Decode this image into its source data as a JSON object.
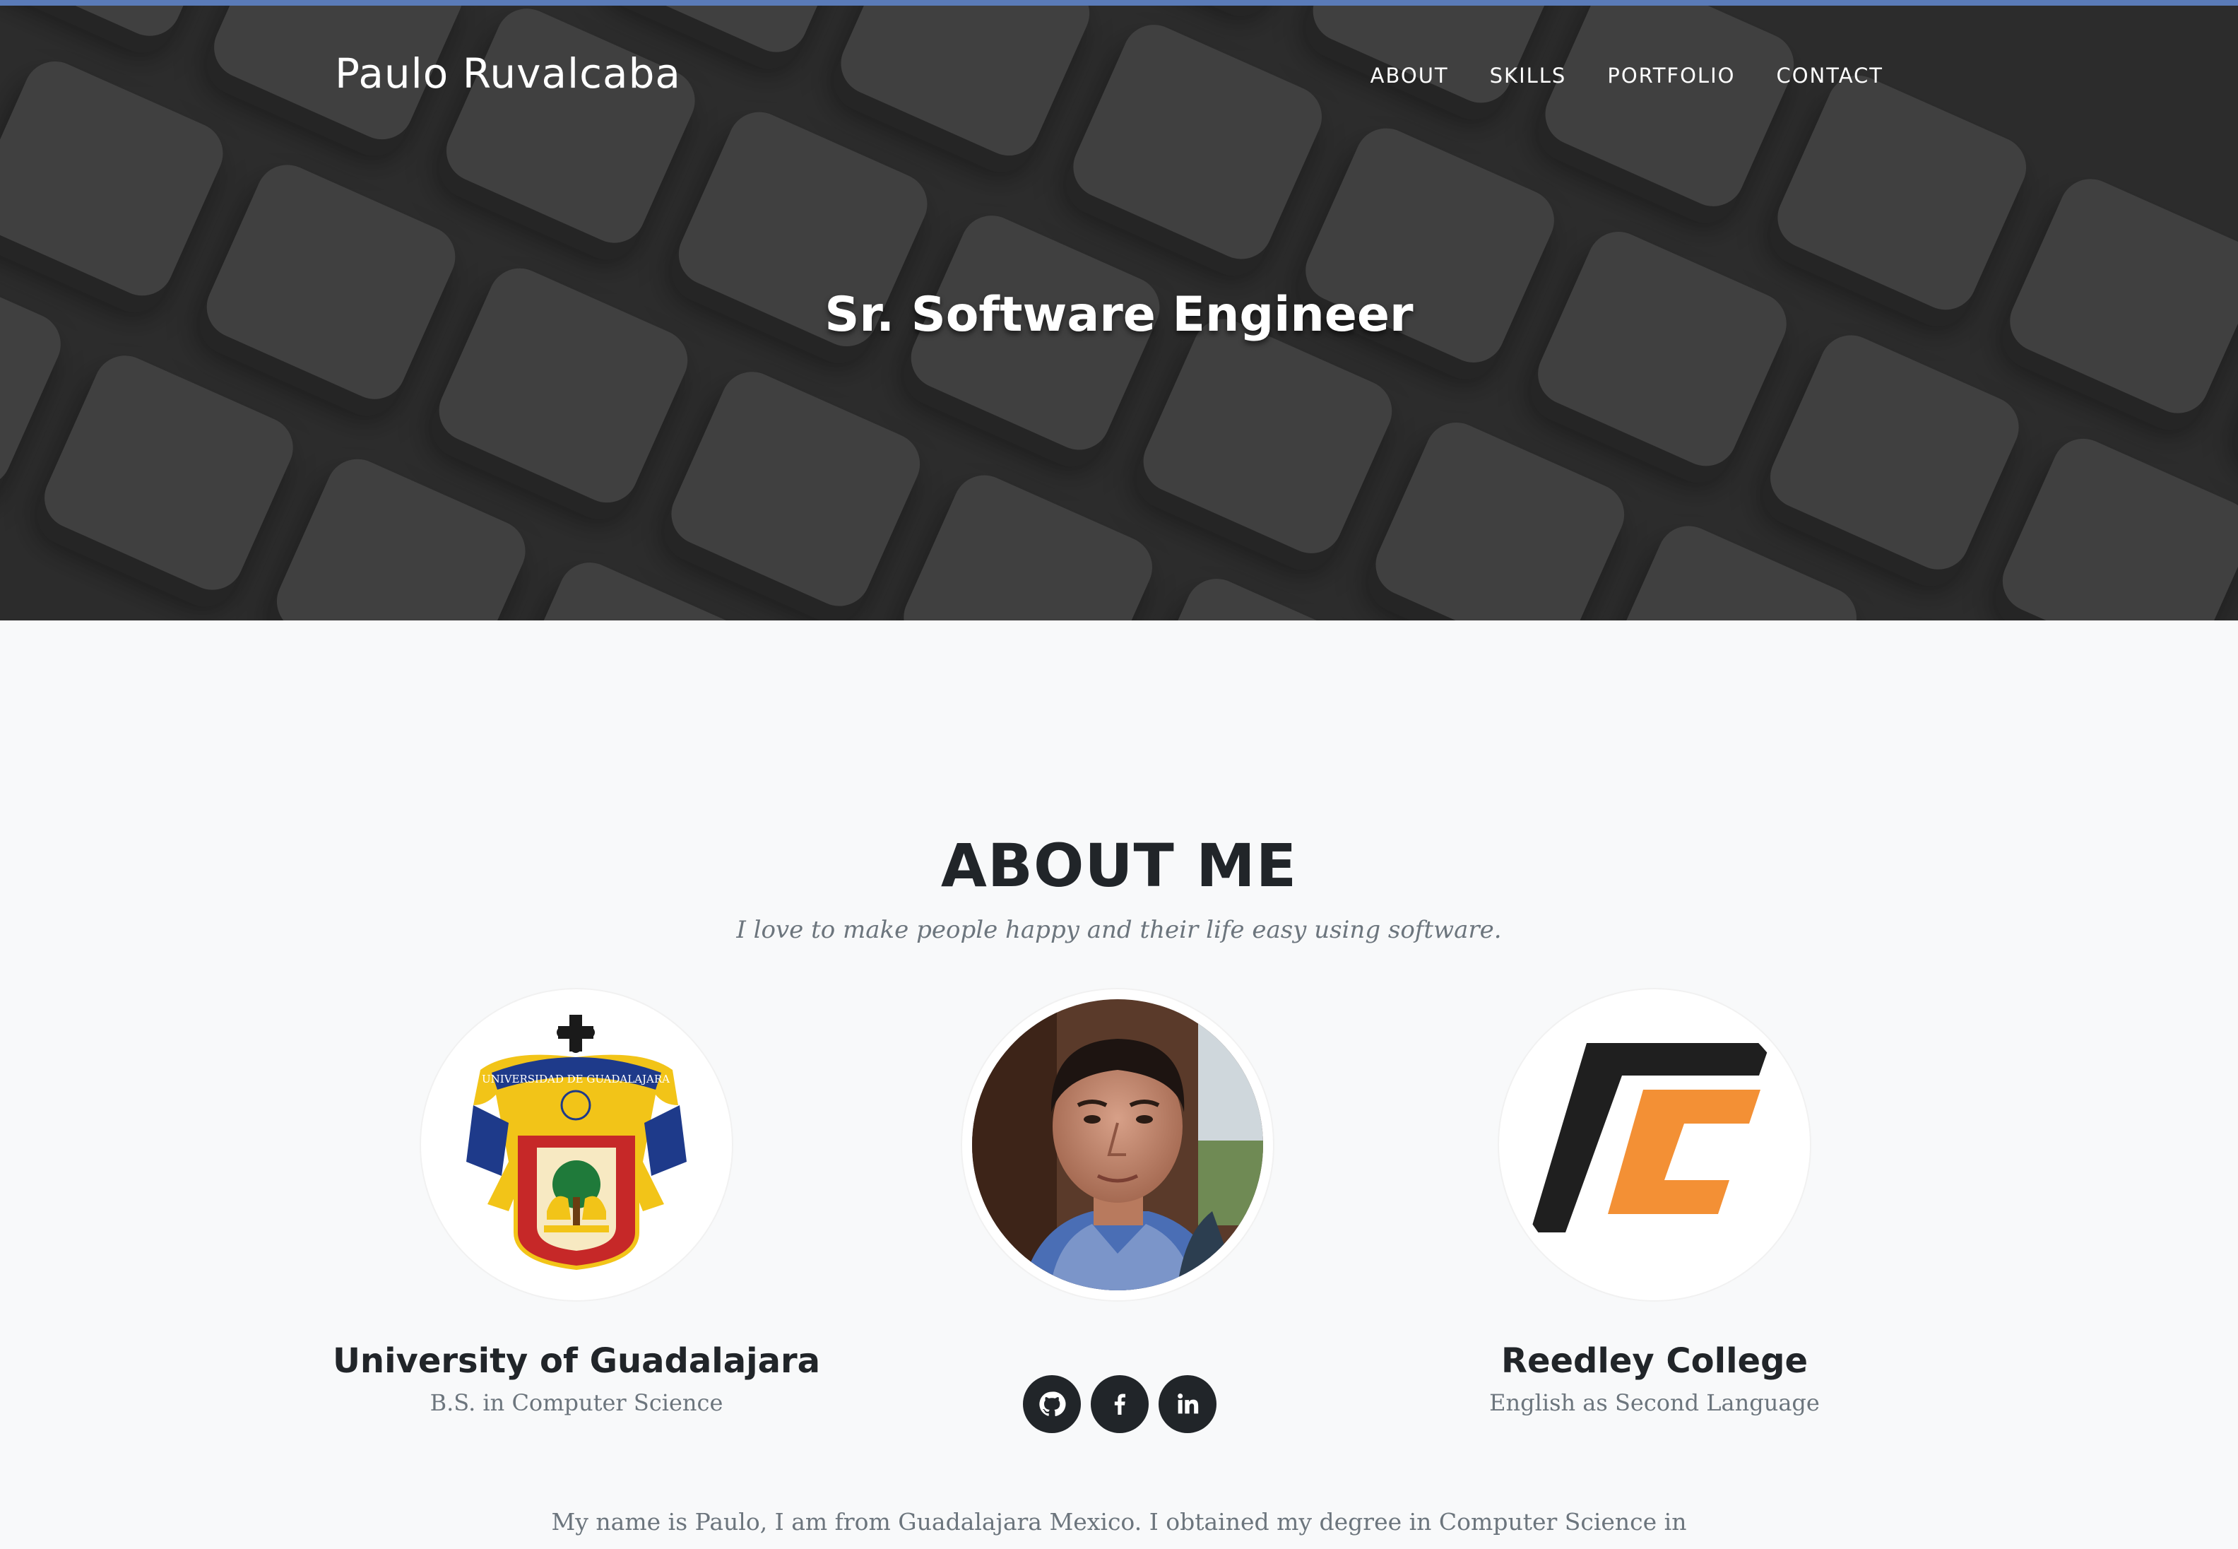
{
  "navbar": {
    "brand": "Paulo Ruvalcaba",
    "links": [
      "ABOUT",
      "SKILLS",
      "PORTFOLIO",
      "CONTACT"
    ]
  },
  "hero": {
    "title": "Sr. Software Engineer"
  },
  "about": {
    "heading": "ABOUT ME",
    "subheading": "I love to make people happy and their life easy using software.",
    "schools": [
      {
        "name": "University of Guadalajara",
        "degree": "B.S. in Computer Science"
      },
      {
        "name": "Reedley College",
        "degree": "English as Second Language"
      }
    ],
    "social": [
      "github-icon",
      "facebook-icon",
      "linkedin-icon"
    ],
    "bio": "My name is Paulo, I am from Guadalajara Mexico. I obtained my degree in Computer Science in",
    "logo_text": "UNIVERSIDAD DE GUADALAJARA"
  },
  "colors": {
    "accent_strip": "#5a7bb8",
    "reedley_orange": "#f39035",
    "udg_red": "#c62828",
    "udg_blue": "#1e3a8a"
  }
}
